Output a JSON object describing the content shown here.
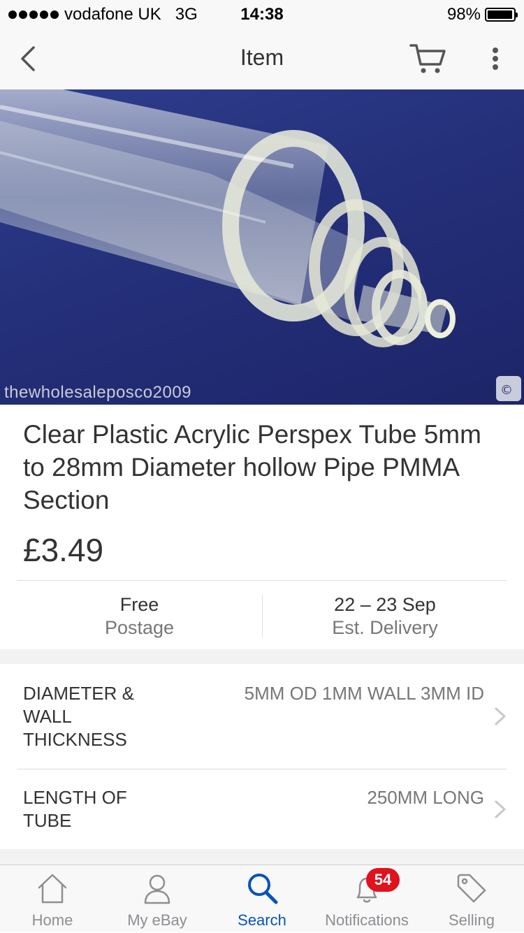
{
  "status_bar": {
    "carrier": "vodafone UK",
    "network": "3G",
    "time": "14:38",
    "battery": "98%",
    "battery_level": 0.98
  },
  "nav": {
    "title": "Item",
    "back_icon": "chevron-left-icon",
    "cart_icon": "cart-icon",
    "more_icon": "more-vertical-icon"
  },
  "hero": {
    "alt": "Clear acrylic tubes of various diameters",
    "watermark": "thewholesaleposco2009"
  },
  "product": {
    "title": "Clear Plastic Acrylic Perspex Tube 5mm to 28mm Diameter hollow Pipe PMMA Section",
    "price": "£3.49"
  },
  "shipping": {
    "postage_main": "Free",
    "postage_sub": "Postage",
    "delivery_main": "22 – 23 Sep",
    "delivery_sub": "Est. Delivery"
  },
  "specs": [
    {
      "label_lines": [
        "DIAMETER &",
        "WALL",
        "THICKNESS"
      ],
      "value": "5MM OD 1MM WALL 3MM ID"
    },
    {
      "label_lines": [
        "LENGTH OF",
        "TUBE"
      ],
      "value": "250MM LONG"
    }
  ],
  "tabs": [
    {
      "label": "Home",
      "icon": "home-icon"
    },
    {
      "label": "My eBay",
      "icon": "user-icon"
    },
    {
      "label": "Search",
      "icon": "search-icon"
    },
    {
      "label": "Notifications",
      "icon": "bell-icon",
      "badge": "54"
    },
    {
      "label": "Selling",
      "icon": "tag-icon"
    }
  ],
  "colors": {
    "accent": "#0654ba",
    "badge": "#e0121d",
    "text": "#333333",
    "muted": "#777777",
    "tab_inactive": "#8e8e93"
  }
}
